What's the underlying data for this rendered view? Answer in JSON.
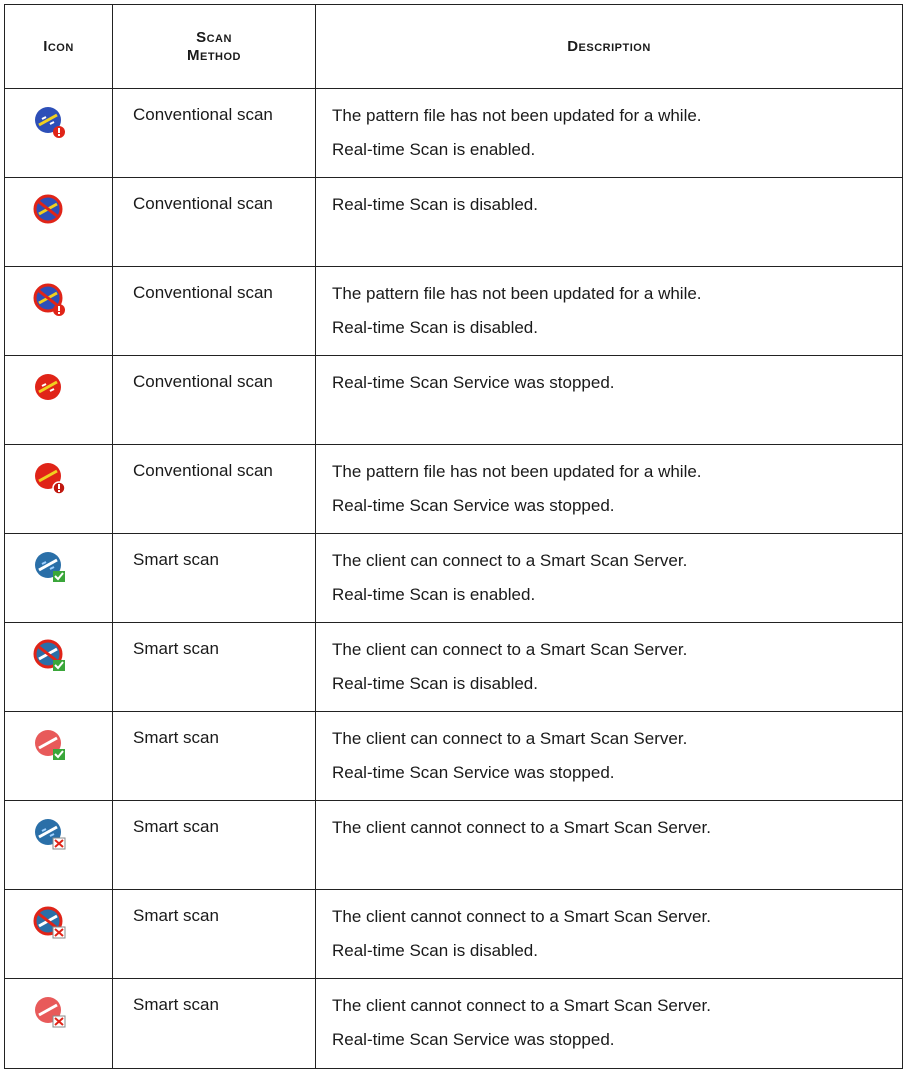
{
  "table": {
    "headers": {
      "icon": "Icon",
      "method_line1": "Scan",
      "method_line2": "Method",
      "description": "Description"
    },
    "rows": [
      {
        "icon": "conventional-scan-outdated-pattern-icon",
        "method": "Conventional scan",
        "desc1": "The pattern file has not been updated for a while.",
        "desc2": "Real-time Scan is enabled."
      },
      {
        "icon": "conventional-scan-realtime-disabled-icon",
        "method": "Conventional scan",
        "desc1": "Real-time Scan is disabled.",
        "desc2": ""
      },
      {
        "icon": "conventional-scan-outdated-disabled-icon",
        "method": "Conventional scan",
        "desc1": "The pattern file has not been updated for a while.",
        "desc2": "Real-time Scan is disabled."
      },
      {
        "icon": "conventional-scan-service-stopped-icon",
        "method": "Conventional scan",
        "desc1": "Real-time Scan Service was stopped.",
        "desc2": ""
      },
      {
        "icon": "conventional-scan-outdated-stopped-icon",
        "method": "Conventional scan",
        "desc1": "The pattern file has not been updated for a while.",
        "desc2": "Real-time Scan Service was stopped."
      },
      {
        "icon": "smart-scan-connected-enabled-icon",
        "method": "Smart scan",
        "desc1": "The client can connect to a Smart Scan Server.",
        "desc2": "Real-time Scan is enabled."
      },
      {
        "icon": "smart-scan-connected-disabled-icon",
        "method": "Smart scan",
        "desc1": "The client can connect to a Smart Scan Server.",
        "desc2": "Real-time Scan is disabled."
      },
      {
        "icon": "smart-scan-connected-stopped-icon",
        "method": "Smart scan",
        "desc1": "The client can connect to a Smart Scan Server.",
        "desc2": "Real-time Scan Service was stopped."
      },
      {
        "icon": "smart-scan-disconnected-icon",
        "method": "Smart scan",
        "desc1": "The client cannot connect to a Smart Scan Server.",
        "desc2": ""
      },
      {
        "icon": "smart-scan-disconnected-disabled-icon",
        "method": "Smart scan",
        "desc1": "The client cannot connect to a Smart Scan Server.",
        "desc2": "Real-time Scan is disabled."
      },
      {
        "icon": "smart-scan-disconnected-stopped-icon",
        "method": "Smart scan",
        "desc1": "The client cannot connect to a Smart Scan Server.",
        "desc2": "Real-time Scan Service was stopped."
      }
    ]
  },
  "colors": {
    "blue": "#2d4fb8",
    "red": "#e02418",
    "pale_red": "#e85a5a",
    "check_green": "#3aa63a",
    "border": "#222222"
  }
}
